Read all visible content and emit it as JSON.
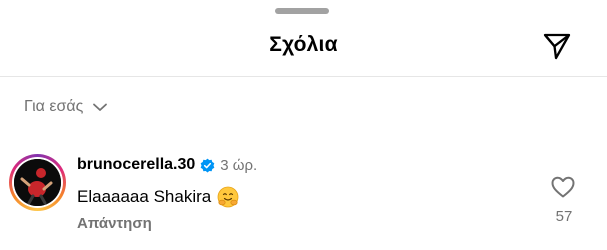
{
  "header": {
    "title": "Σχόλια",
    "share_icon": "paper-plane-icon"
  },
  "sort": {
    "label": "Για εσάς",
    "icon": "chevron-down-icon"
  },
  "comments": [
    {
      "username": "brunocerella.30",
      "verified": true,
      "time": "3 ώρ.",
      "text": "Elaaaaaa Shakira",
      "emoji": "hugging-face",
      "reply_label": "Απάντηση",
      "like_count": "57",
      "has_story_ring": true
    }
  ],
  "colors": {
    "secondary_text": "#737373",
    "verified_blue": "#0095f6"
  }
}
